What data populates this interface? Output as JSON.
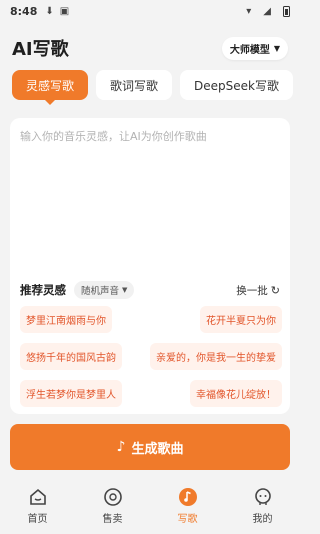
{
  "status": {
    "time": "8:48"
  },
  "header": {
    "title": "AI写歌",
    "model_label": "大师模型"
  },
  "tabs": [
    {
      "label": "灵感写歌",
      "active": true
    },
    {
      "label": "歌词写歌",
      "active": false
    },
    {
      "label": "DeepSeek写歌",
      "active": false
    }
  ],
  "editor": {
    "placeholder": "输入你的音乐灵感，让AI为你创作歌曲",
    "value": ""
  },
  "recommend": {
    "title": "推荐灵感",
    "mode": "随机声音",
    "refresh_label": "换一批",
    "chips": [
      [
        "梦里江南烟雨与你",
        "花开半夏只为你"
      ],
      [
        "悠扬千年的国风古韵",
        "亲爱的，你是我一生的挚爱"
      ],
      [
        "浮生若梦你是梦里人",
        "幸福像花儿绽放！"
      ]
    ]
  },
  "generate_button": {
    "label": "生成歌曲"
  },
  "bottom_nav": [
    {
      "label": "首页",
      "icon": "home-icon",
      "active": false
    },
    {
      "label": "售卖",
      "icon": "disc-icon",
      "active": false
    },
    {
      "label": "写歌",
      "icon": "music-note-icon",
      "active": true
    },
    {
      "label": "我的",
      "icon": "profile-icon",
      "active": false
    }
  ],
  "colors": {
    "accent": "#f07a2a",
    "chip_bg": "#fff2ec",
    "chip_text": "#e2552a",
    "bg": "#f3f3f3"
  }
}
